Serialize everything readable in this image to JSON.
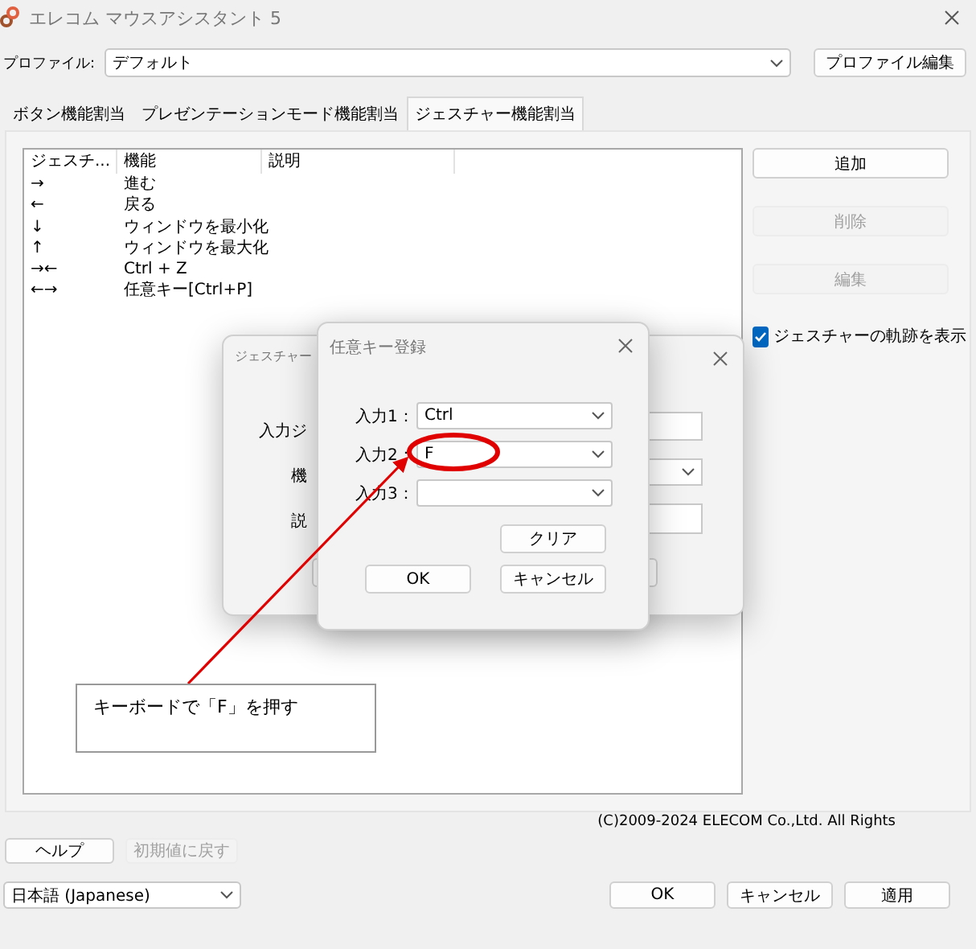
{
  "window": {
    "title": "エレコム マウスアシスタント 5"
  },
  "profile": {
    "label": "プロファイル:",
    "value": "デフォルト",
    "edit_button": "プロファイル編集"
  },
  "tabs": [
    {
      "label": "ボタン機能割当",
      "selected": false
    },
    {
      "label": "プレゼンテーションモード機能割当",
      "selected": false
    },
    {
      "label": "ジェスチャー機能割当",
      "selected": true
    }
  ],
  "gesture_list": {
    "columns": [
      "ジェスチ...",
      "機能",
      "説明"
    ],
    "rows": [
      {
        "gesture": "→",
        "function": "進む"
      },
      {
        "gesture": "←",
        "function": "戻る"
      },
      {
        "gesture": "↓",
        "function": "ウィンドウを最小化"
      },
      {
        "gesture": "↑",
        "function": "ウィンドウを最大化"
      },
      {
        "gesture": "→←",
        "function": "Ctrl + Z"
      },
      {
        "gesture": "←→",
        "function": "任意キー[Ctrl+P]"
      }
    ]
  },
  "side_buttons": [
    {
      "label": "追加",
      "disabled": false
    },
    {
      "label": "削除",
      "disabled": true
    },
    {
      "label": "編集",
      "disabled": true
    }
  ],
  "show_trail": {
    "label": "ジェスチャーの軌跡を表示",
    "checked": true
  },
  "copyright": "(C)2009-2024 ELECOM Co.,Ltd. All Rights",
  "bottom_buttons": [
    {
      "label": "ヘルプ",
      "disabled": false
    },
    {
      "label": "初期値に戻す",
      "disabled": true
    }
  ],
  "language": "日本語 (Japanese)",
  "footer_buttons": [
    "OK",
    "キャンセル",
    "適用"
  ],
  "gesture_dialog": {
    "title": "ジェスチャー",
    "labels": [
      "入力ジ",
      "機",
      "説"
    ]
  },
  "key_dialog": {
    "title": "任意キー登録",
    "inputs": [
      {
        "label": "入力1：",
        "value": "Ctrl"
      },
      {
        "label": "入力2：",
        "value": "F"
      },
      {
        "label": "入力3："
      }
    ],
    "clear_button": "クリア",
    "buttons": [
      "OK",
      "キャンセル"
    ]
  },
  "annotation": {
    "text": "キーボードで「F」を押す"
  }
}
